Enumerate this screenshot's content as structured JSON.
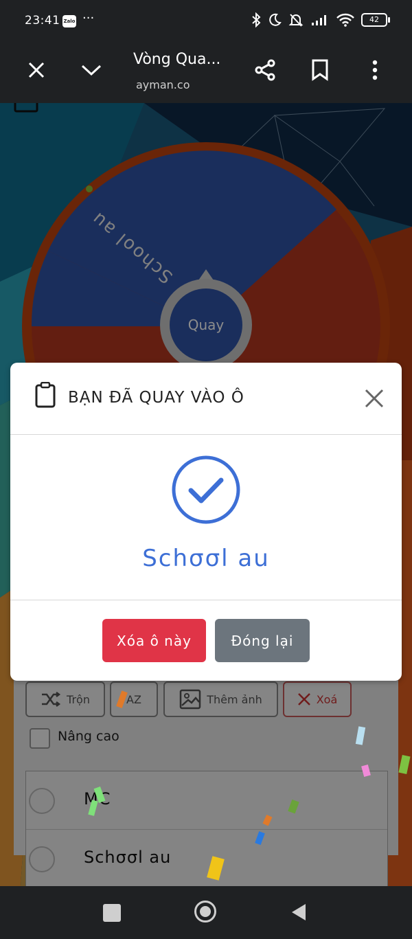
{
  "status_bar": {
    "time": "23:41",
    "zalo_label": "Zalo",
    "more_label": "···",
    "battery": "42"
  },
  "browser": {
    "title": "Vòng Qua...",
    "url": "ayman.co"
  },
  "wheel": {
    "segment_label": "School au",
    "spin_label": "Quay"
  },
  "modal": {
    "title": "BẠN ĐÃ QUAY VÀO Ô",
    "result": "Schσσl au",
    "remove_button": "Xóa ô này",
    "close_button": "Đóng lại",
    "remove_color": "#e03447",
    "close_color": "#6c757d",
    "accent": "#3d6fd6"
  },
  "controls": {
    "shuffle_label": "Trộn",
    "az_label": "AZ",
    "add_image_label": "Thêm ảnh",
    "delete_label": "Xoá",
    "advanced_label": "Nâng cao"
  },
  "entries": [
    {
      "label": "MC"
    },
    {
      "label": "Schσσl au"
    }
  ]
}
